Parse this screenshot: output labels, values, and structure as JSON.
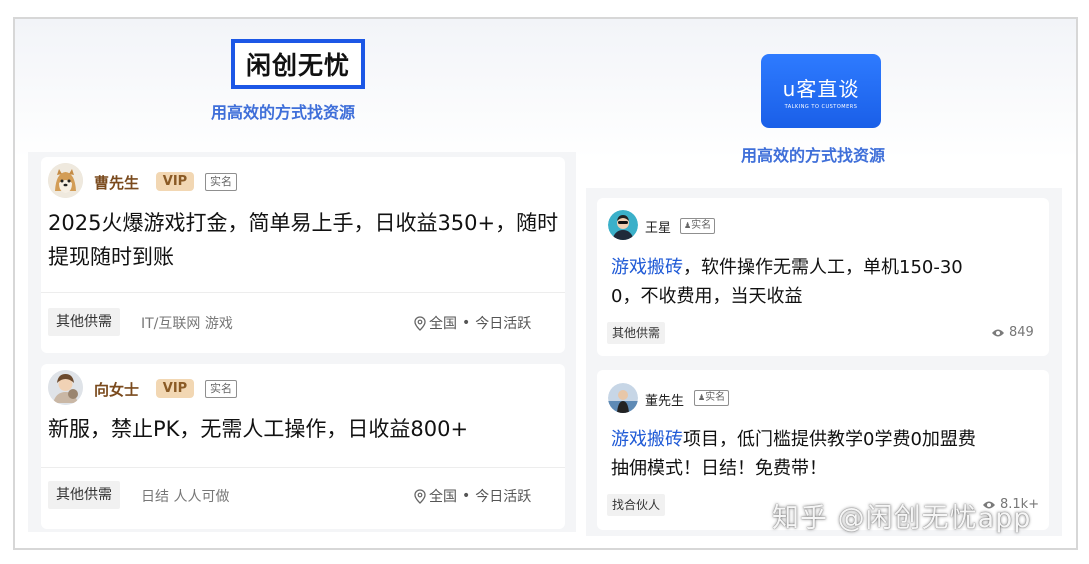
{
  "left_brand": {
    "name": "闲创无忧",
    "slogan": "用高效的方式找资源"
  },
  "right_brand": {
    "name": "u客直谈",
    "subtitle": "TALKING TO CUSTOMERS",
    "slogan": "用高效的方式找资源"
  },
  "left_posts": [
    {
      "user": "曹先生",
      "vip": "VIP",
      "verified": "实名",
      "title": "2025火爆游戏打金，简单易上手，日收益350+，随时提现随时到账",
      "category": "其他供需",
      "tags": "IT/互联网  游戏",
      "location": "全国",
      "activity": "今日活跃"
    },
    {
      "user": "向女士",
      "vip": "VIP",
      "verified": "实名",
      "title": "新服，禁止PK，无需人工操作，日收益800+",
      "category": "其他供需",
      "tags": "日结  人人可做",
      "location": "全国",
      "activity": "今日活跃"
    }
  ],
  "right_posts": [
    {
      "user": "王星",
      "verified": "实名",
      "highlight": "游戏搬砖",
      "title_line1": "，软件操作无需人工，单机150-30",
      "title_line2": "0，不收费用，当天收益",
      "category": "其他供需",
      "views": "849"
    },
    {
      "user": "董先生",
      "verified": "实名",
      "highlight": "游戏搬砖",
      "title_line1": "项目，低门槛提供教学0学费0加盟费",
      "title_line2": "抽佣模式！日结！免费带！",
      "category": "找合伙人",
      "views": "8.1k+"
    }
  ],
  "watermark": "知乎 @闲创无忧app"
}
